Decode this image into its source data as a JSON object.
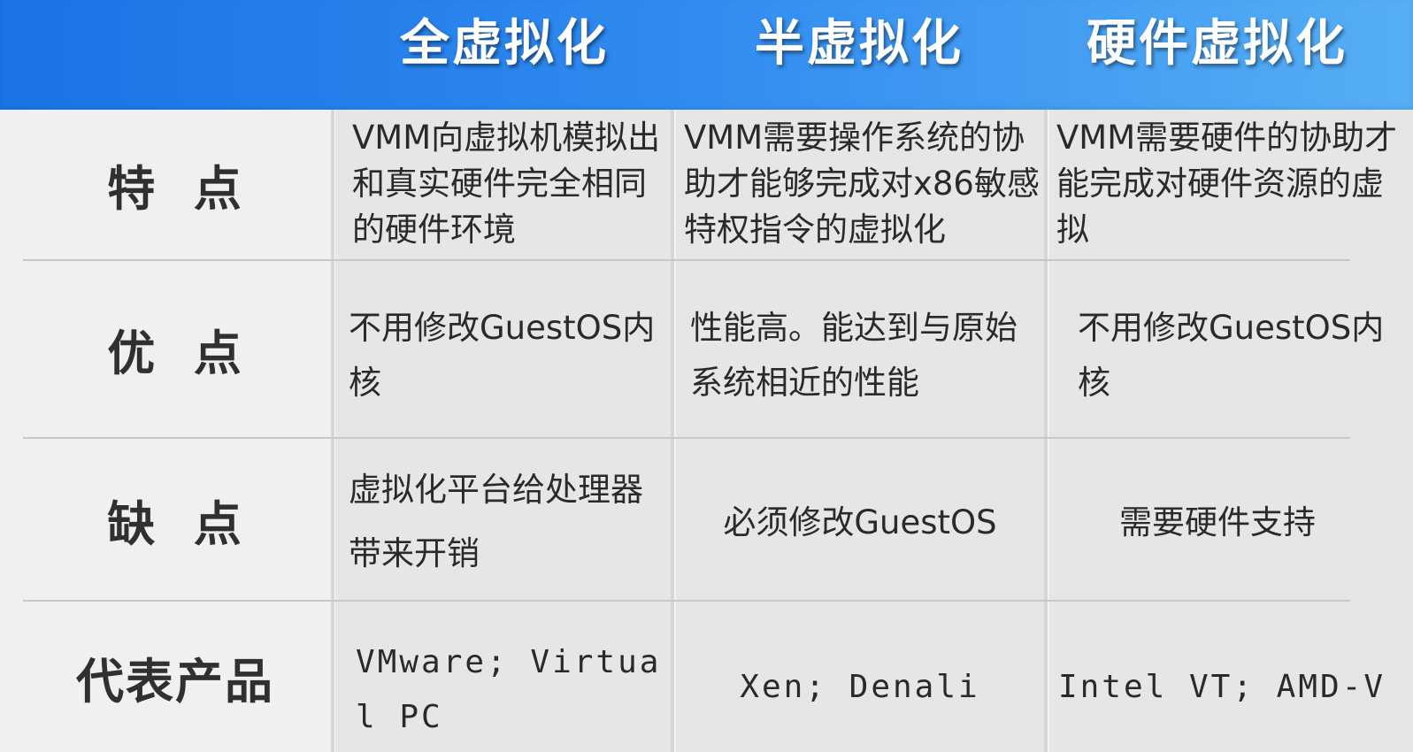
{
  "header": {
    "columns": [
      "全虚拟化",
      "半虚拟化",
      "硬件虚拟化"
    ]
  },
  "rows": [
    {
      "label": "特  点",
      "cells": [
        "VMM向虚拟机模拟出和真实硬件完全相同的硬件环境",
        "VMM需要操作系统的协助才能够完成对x86敏感特权指令的虚拟化",
        "VMM需要硬件的协助才能完成对硬件资源的虚拟"
      ]
    },
    {
      "label": "优  点",
      "cells": [
        "不用修改GuestOS内核",
        "性能高。能达到与原始系统相近的性能",
        "不用修改GuestOS内核"
      ]
    },
    {
      "label": "缺  点",
      "cells": [
        "虚拟化平台给处理器带来开销",
        "必须修改GuestOS",
        "需要硬件支持"
      ]
    },
    {
      "label": "代表产品",
      "cells": [
        "VMware; Virtual PC",
        "Xen; Denali",
        "Intel VT; AMD-V"
      ]
    }
  ],
  "colors": {
    "header_start": "#1a73e6",
    "header_end": "#56aef5",
    "background": "#f0f0f0",
    "cell_fill": "#e6e6e6",
    "text": "#2a2a2a"
  }
}
